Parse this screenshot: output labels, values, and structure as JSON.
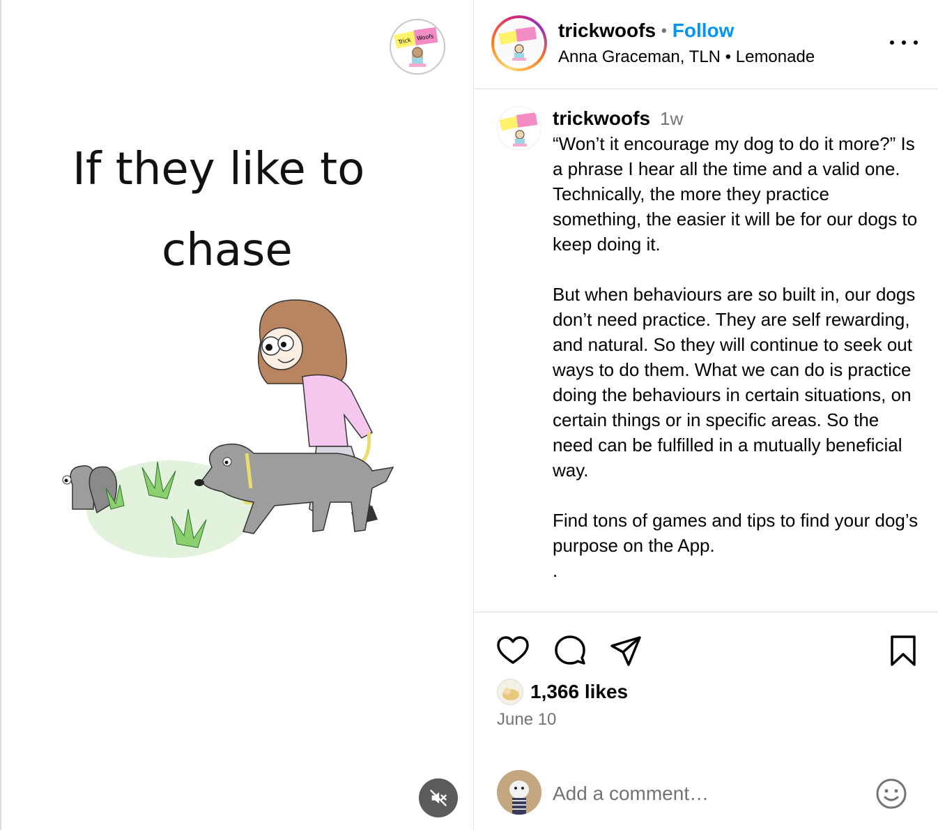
{
  "media": {
    "caption_line1": "If they like to",
    "caption_line2": "chase",
    "logo_text": "Trick Woofs",
    "mute_icon": "muted-speaker-icon"
  },
  "header": {
    "username": "trickwoofs",
    "separator": "•",
    "follow_label": "Follow",
    "subtitle": "Anna Graceman, TLN • Lemonade",
    "more_icon": "more-horizontal-icon"
  },
  "caption": {
    "username": "trickwoofs",
    "time": "1w",
    "text": "“Won’t it encourage my dog to do it more?” Is a phrase I hear all the time and a valid one. Technically, the more they practice something, the easier it will be for our dogs to keep doing it.\n\nBut when behaviours are so built in, our dogs don’t need practice. They are self rewarding, and natural. So they will continue to seek out ways to do them. What we can do is practice doing the behaviours in certain situations, on certain things or in specific areas. So the need can be fulfilled in a mutually beneficial way.\n\nFind tons of games and tips to find your dog’s purpose on the App.\n."
  },
  "actions": {
    "like_icon": "heart-icon",
    "comment_icon": "comment-icon",
    "share_icon": "share-icon",
    "save_icon": "bookmark-icon",
    "likes": "1,366 likes",
    "date": "June 10"
  },
  "comment": {
    "placeholder": "Add a comment…",
    "emoji_icon": "emoji-icon"
  },
  "colors": {
    "link_blue": "#0095f6",
    "muted_text": "#737373",
    "divider": "#dbdbdb"
  }
}
